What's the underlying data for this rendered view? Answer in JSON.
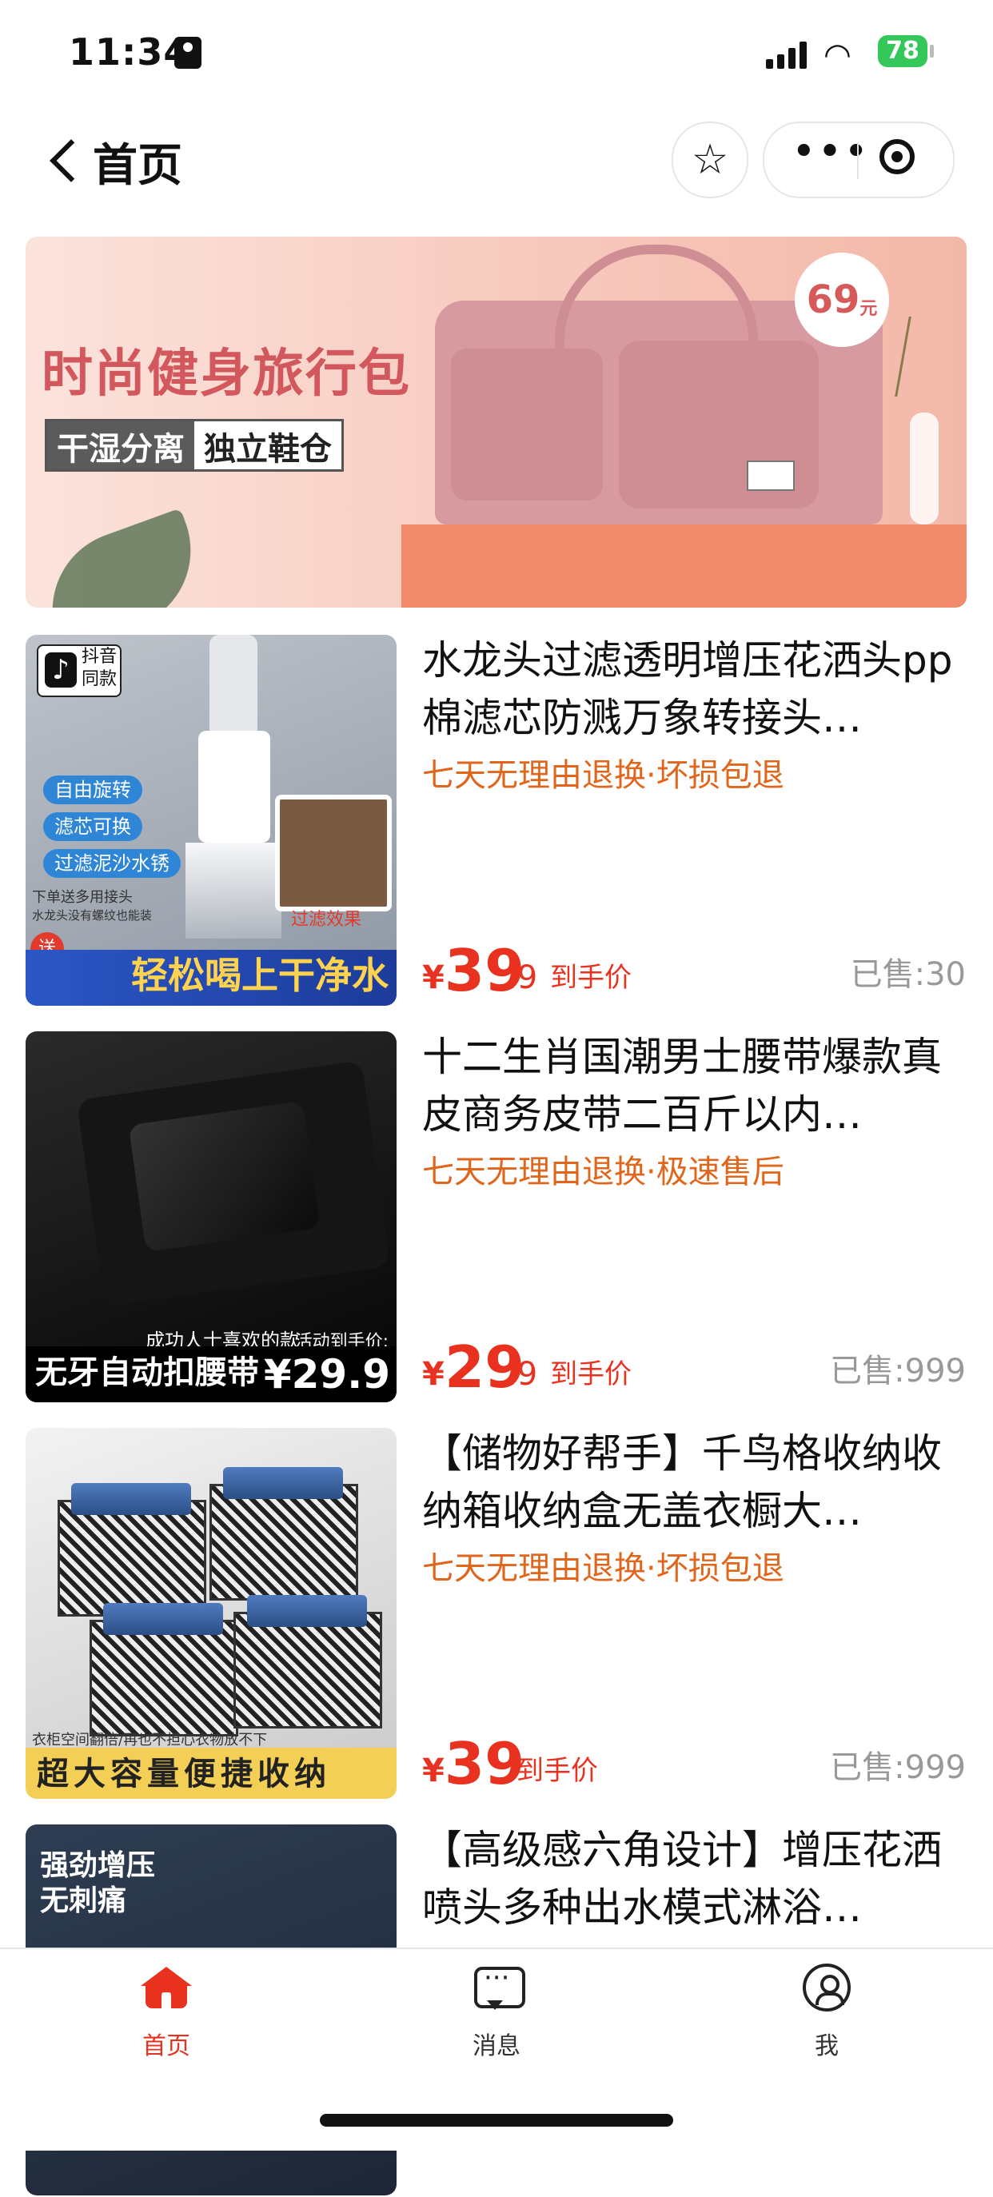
{
  "status_bar": {
    "time": "11:34",
    "battery": "78"
  },
  "nav": {
    "title": "首页"
  },
  "banner": {
    "headline": "时尚健身旅行包",
    "feature_a": "干湿分离",
    "feature_b": "独立鞋仓",
    "price": "69",
    "price_unit": "元"
  },
  "products": [
    {
      "title": "水龙头过滤透明增压花洒头pp棉滤芯防溅万象转接头…",
      "tag": "七天无理由退换·坏损包退",
      "price_int": "39",
      "price_dec": ".9",
      "suffix": "到手价",
      "sold": "已售:30",
      "thumb_labels": {
        "badge_line1": "抖音",
        "badge_line2": "同款",
        "chip1": "自由旋转",
        "chip2": "滤芯可换",
        "chip3": "过滤泥沙水锈",
        "inset": "过滤效果",
        "note_line1": "下单送多用接头",
        "note_line2": "水龙头没有螺纹也能装",
        "send": "送",
        "strip": "轻松喝上干净水"
      }
    },
    {
      "title": "十二生肖国潮男士腰带爆款真皮商务皮带二百斤以内…",
      "tag": "七天无理由退换·极速售后",
      "price_int": "29",
      "price_dec": ".9",
      "suffix": "到手价",
      "sold": "已售:999",
      "thumb_labels": {
        "top": "成功人士喜欢的款",
        "promo": "活动到手价:",
        "strip": "无牙自动扣腰带",
        "price": "¥29.9"
      }
    },
    {
      "title": "【储物好帮手】千鸟格收纳收纳箱收纳盒无盖衣橱大…",
      "tag": "七天无理由退换·坏损包退",
      "price_int": "39",
      "price_dec": "",
      "suffix": "到手价",
      "sold": "已售:999",
      "thumb_labels": {
        "note": "衣柜空间翻倍/再也不担心衣物放不下",
        "strip": "超大容量便捷收纳"
      }
    },
    {
      "title": "【高级感六角设计】增压花洒喷头多种出水模式淋浴…",
      "thumb_labels": {
        "line1": "强劲增压",
        "line2": "无刺痛"
      }
    }
  ],
  "tabbar": {
    "home": "首页",
    "messages": "消息",
    "me": "我"
  },
  "colors": {
    "accent_red": "#e8321f",
    "tag_orange": "#e0661b",
    "sold_gray": "#999999"
  }
}
